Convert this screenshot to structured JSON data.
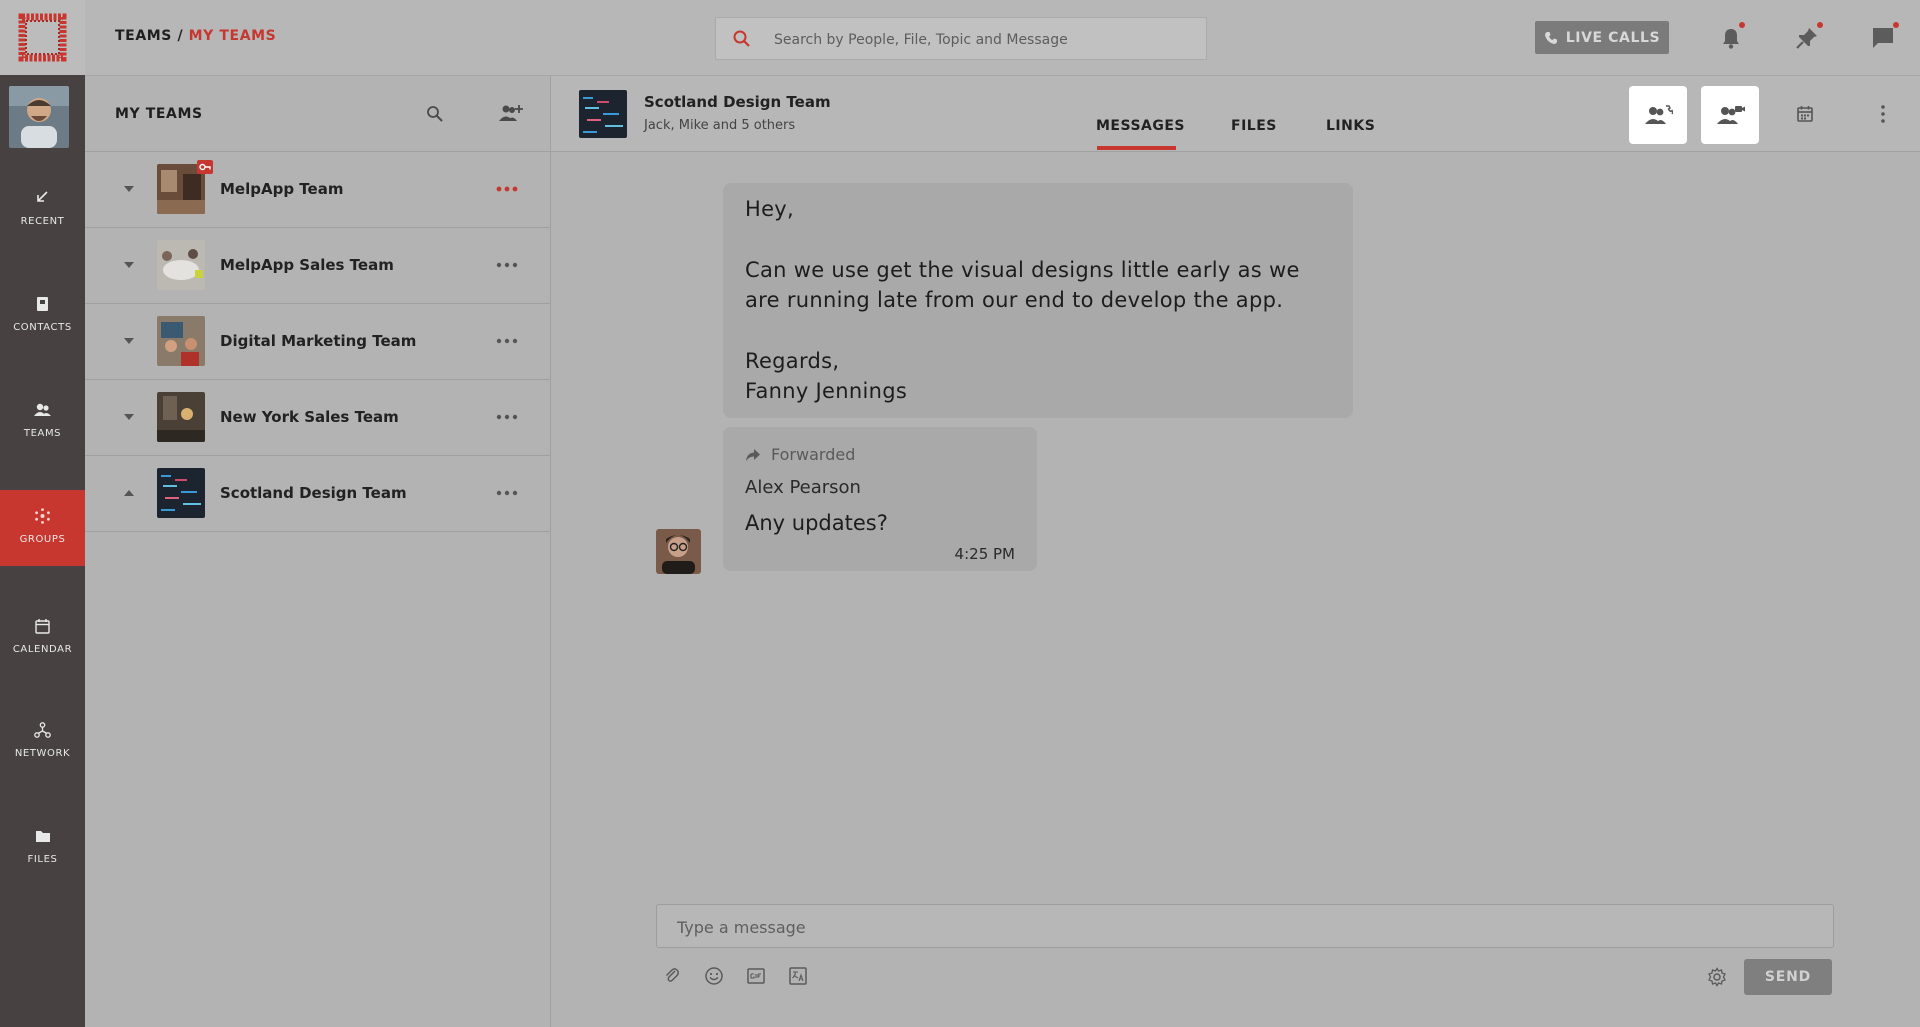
{
  "nav": {
    "items": [
      {
        "label": "RECENT",
        "icon": "recent-icon"
      },
      {
        "label": "CONTACTS",
        "icon": "contacts-icon"
      },
      {
        "label": "TEAMS",
        "icon": "teams-icon"
      },
      {
        "label": "GROUPS",
        "icon": "groups-icon",
        "active": true
      },
      {
        "label": "CALENDAR",
        "icon": "calendar-icon"
      },
      {
        "label": "NETWORK",
        "icon": "network-icon"
      },
      {
        "label": "FILES",
        "icon": "files-icon"
      }
    ]
  },
  "topbar": {
    "breadcrumb_root": "TEAMS",
    "breadcrumb_sep": " / ",
    "breadcrumb_current": "MY TEAMS",
    "search_placeholder": "Search by People, File, Topic and Message",
    "live_calls": "LIVE CALLS"
  },
  "teams": {
    "title": "MY TEAMS",
    "list": [
      {
        "name": "MelpApp Team",
        "expanded": false,
        "badge": "key-icon",
        "active_more": true
      },
      {
        "name": "MelpApp Sales Team",
        "expanded": false
      },
      {
        "name": "Digital Marketing Team",
        "expanded": false
      },
      {
        "name": "New York Sales Team",
        "expanded": false
      },
      {
        "name": "Scotland Design Team",
        "expanded": true
      }
    ]
  },
  "conversation": {
    "title": "Scotland Design Team",
    "subtitle": "Jack, Mike and 5 others",
    "tabs": [
      "MESSAGES",
      "FILES",
      "LINKS"
    ],
    "active_tab": "MESSAGES"
  },
  "messages": {
    "m1_lines": [
      "Hey,",
      "",
      "Can we use get the visual designs little early as we",
      "are running late from our end to develop the app.",
      "",
      "Regards,",
      "Fanny Jennings"
    ],
    "m2": {
      "forwarded_label": "Forwarded",
      "author": "Alex Pearson",
      "text": "Any updates?",
      "time": "4:25 PM"
    }
  },
  "composer": {
    "placeholder": "Type a message",
    "send": "SEND"
  },
  "colors": {
    "accent": "#c7372f",
    "nav_bg": "#474141",
    "bg": "#b3b3b3"
  }
}
